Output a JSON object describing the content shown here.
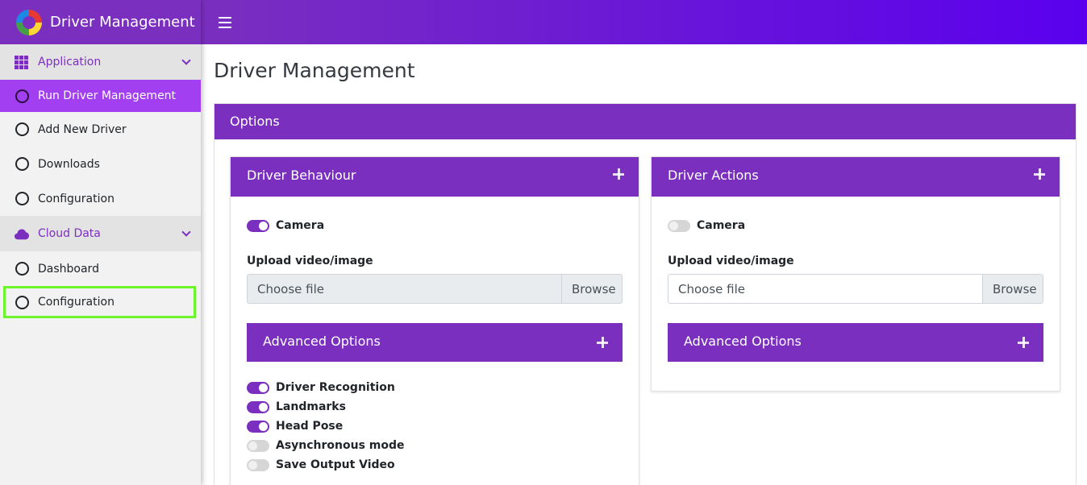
{
  "app": {
    "title": "Driver Management"
  },
  "sidebar": {
    "sections": [
      {
        "label": "Application",
        "icon": "grid-icon",
        "items": [
          {
            "label": "Run Driver Management",
            "active": true
          },
          {
            "label": "Add New Driver"
          },
          {
            "label": "Downloads"
          },
          {
            "label": "Configuration"
          }
        ]
      },
      {
        "label": "Cloud Data",
        "icon": "cloud-icon",
        "items": [
          {
            "label": "Dashboard"
          },
          {
            "label": "Configuration",
            "highlighted": true
          }
        ]
      }
    ]
  },
  "page": {
    "title": "Driver Management"
  },
  "options": {
    "title": "Options",
    "behaviour": {
      "title": "Driver Behaviour",
      "camera": {
        "label": "Camera",
        "on": true
      },
      "upload_label": "Upload video/image",
      "file_placeholder": "Choose file",
      "browse_label": "Browse",
      "advanced": {
        "title": "Advanced Options",
        "toggles": [
          {
            "label": "Driver Recognition",
            "on": true
          },
          {
            "label": "Landmarks",
            "on": true
          },
          {
            "label": "Head Pose",
            "on": true
          },
          {
            "label": "Asynchronous mode",
            "on": false
          },
          {
            "label": "Save Output Video",
            "on": false
          }
        ]
      }
    },
    "actions": {
      "title": "Driver Actions",
      "camera": {
        "label": "Camera",
        "on": false
      },
      "upload_label": "Upload video/image",
      "file_placeholder": "Choose file",
      "browse_label": "Browse",
      "advanced": {
        "title": "Advanced Options"
      }
    }
  },
  "colors": {
    "accent": "#7b2fbf",
    "active_item": "#a23ff0",
    "topbar_end": "#5a00ee",
    "highlight": "#6cf52a"
  }
}
